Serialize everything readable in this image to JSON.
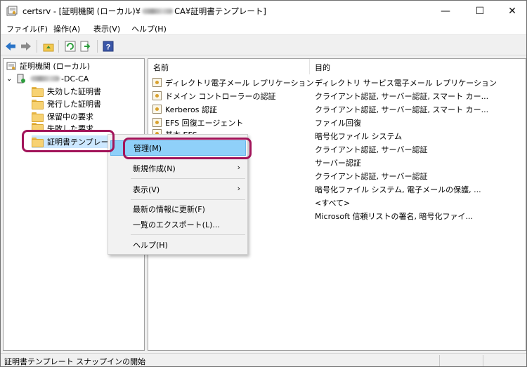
{
  "window": {
    "title_prefix": "certsrv - [証明機関 (ローカル)¥",
    "title_suffix": "CA¥証明書テンプレート]",
    "minimize_glyph": "—",
    "maximize_glyph": "☐",
    "close_glyph": "✕"
  },
  "menubar": {
    "items": [
      {
        "label": "ファイル(F)"
      },
      {
        "label": "操作(A)"
      },
      {
        "label": "表示(V)"
      },
      {
        "label": "ヘルプ(H)"
      }
    ]
  },
  "toolbar": {
    "icons": [
      "back-arrow-icon",
      "forward-arrow-icon",
      "up-folder-icon",
      "refresh-icon",
      "export-icon",
      "help-icon"
    ],
    "help_glyph": "?"
  },
  "tree": {
    "root_label": "証明機関 (ローカル)",
    "ca_node_suffix": "-DC-CA",
    "children": [
      {
        "label": "失効した証明書"
      },
      {
        "label": "発行した証明書"
      },
      {
        "label": "保留中の要求"
      },
      {
        "label": "失敗した要求"
      },
      {
        "label": "証明書テンプレート"
      }
    ]
  },
  "list": {
    "col_name": "名前",
    "col_purpose": "目的",
    "rows": [
      {
        "name": "ディレクトリ電子メール レプリケーション",
        "purpose": "ディレクトリ サービス電子メール レプリケーション"
      },
      {
        "name": "ドメイン コントローラーの認証",
        "purpose": "クライアント認証, サーバー認証, スマート カー..."
      },
      {
        "name": "Kerberos 認証",
        "purpose": "クライアント認証, サーバー認証, スマート カー..."
      },
      {
        "name": "EFS 回復エージェント",
        "purpose": "ファイル回復"
      },
      {
        "name": "基本 EFS",
        "purpose": "暗号化ファイル システム"
      },
      {
        "name": "",
        "purpose": "クライアント認証, サーバー認証"
      },
      {
        "name": "",
        "purpose": "サーバー認証"
      },
      {
        "name": "",
        "purpose": "クライアント認証, サーバー認証"
      },
      {
        "name": "",
        "purpose": "暗号化ファイル システム, 電子メールの保護, ..."
      },
      {
        "name": "",
        "purpose": "<すべて>"
      },
      {
        "name": "",
        "purpose": "Microsoft 信頼リストの署名, 暗号化ファイ..."
      }
    ]
  },
  "context_menu": {
    "items": [
      {
        "label": "管理(M)"
      },
      {
        "label": "新規作成(N)"
      },
      {
        "label": "表示(V)"
      },
      {
        "label": "最新の情報に更新(F)"
      },
      {
        "label": "一覧のエクスポート(L)..."
      },
      {
        "label": "ヘルプ(H)"
      }
    ],
    "submenu_arrow": "›"
  },
  "statusbar": {
    "text": "証明書テンプレート スナップインの開始"
  },
  "colors": {
    "callout": "#a2145a",
    "menu_highlight": "#8fd0f9"
  }
}
